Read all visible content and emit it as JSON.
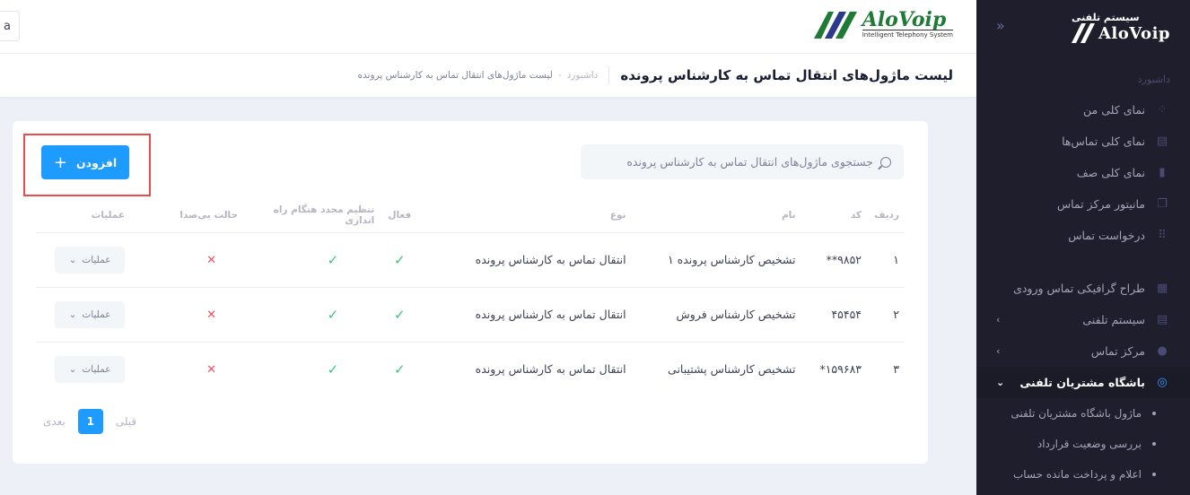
{
  "brand": {
    "sidebar_subtitle": "سیستم تلفنی",
    "sidebar_name": "AloVoip",
    "header_name": "AloVoip",
    "header_tagline": "Intelligent Telephony System"
  },
  "header": {
    "user_initial": "a"
  },
  "subheader": {
    "title": "لیست ماژول‌های انتقال تماس به کارشناس پرونده",
    "breadcrumb_home": "داشبورد",
    "breadcrumb_sep": "-",
    "breadcrumb_current": "لیست ماژول‌های انتقال تماس به کارشناس پرونده"
  },
  "sidebar": {
    "toggle": "«",
    "section": "داشبورد",
    "items": [
      {
        "label": "نمای کلی من",
        "icon": "dashboard-icon"
      },
      {
        "label": "نمای کلی تماس‌ها",
        "icon": "calls-icon"
      },
      {
        "label": "نمای کلی صف",
        "icon": "queue-icon"
      },
      {
        "label": "مانیتور مرکز تماس",
        "icon": "monitor-icon"
      },
      {
        "label": "درخواست تماس",
        "icon": "grid-icon"
      }
    ],
    "items2": [
      {
        "label": "طراح گرافیکی تماس ورودی",
        "icon": "designer-icon"
      },
      {
        "label": "سیستم تلفنی",
        "icon": "phone-system-icon"
      },
      {
        "label": "مرکز تماس",
        "icon": "agent-icon"
      },
      {
        "label": "باشگاه مشتریان تلفنی",
        "icon": "club-icon"
      }
    ],
    "sub": [
      {
        "label": "ماژول باشگاه مشتریان تلفنی"
      },
      {
        "label": "بررسی وضعیت قرارداد"
      },
      {
        "label": "اعلام و پرداخت مانده حساب"
      }
    ]
  },
  "toolbar": {
    "search_placeholder": "جستجوی ماژول‌های انتقال تماس به کارشناس پرونده",
    "add_label": "افزودن",
    "add_icon": "+"
  },
  "table": {
    "headers": [
      "ردیف",
      "کد",
      "نام",
      "نوع",
      "فعال",
      "تنظیم مجدد هنگام راه اندازی",
      "حالت بی‌صدا",
      "عملیات"
    ],
    "rows": [
      {
        "row": "۱",
        "code": "۹۸۵۲**",
        "name": "تشخیص کارشناس پرونده ۱",
        "type": "انتقال تماس به کارشناس پرونده",
        "active": "✓",
        "reset": "✓",
        "mute": "✕",
        "ops": "عملیات"
      },
      {
        "row": "۲",
        "code": "۴۵۴۵۴",
        "name": "تشخیص کارشناس فروش",
        "type": "انتقال تماس به کارشناس پرونده",
        "active": "✓",
        "reset": "✓",
        "mute": "✕",
        "ops": "عملیات"
      },
      {
        "row": "۳",
        "code": "۱۵۹۶۸۳*",
        "name": "تشخیص کارشناس پشتیبانی",
        "type": "انتقال تماس به کارشناس پرونده",
        "active": "✓",
        "reset": "✓",
        "mute": "✕",
        "ops": "عملیات"
      }
    ]
  },
  "pagination": {
    "prev": "قبلی",
    "page": "1",
    "next": "بعدی"
  }
}
